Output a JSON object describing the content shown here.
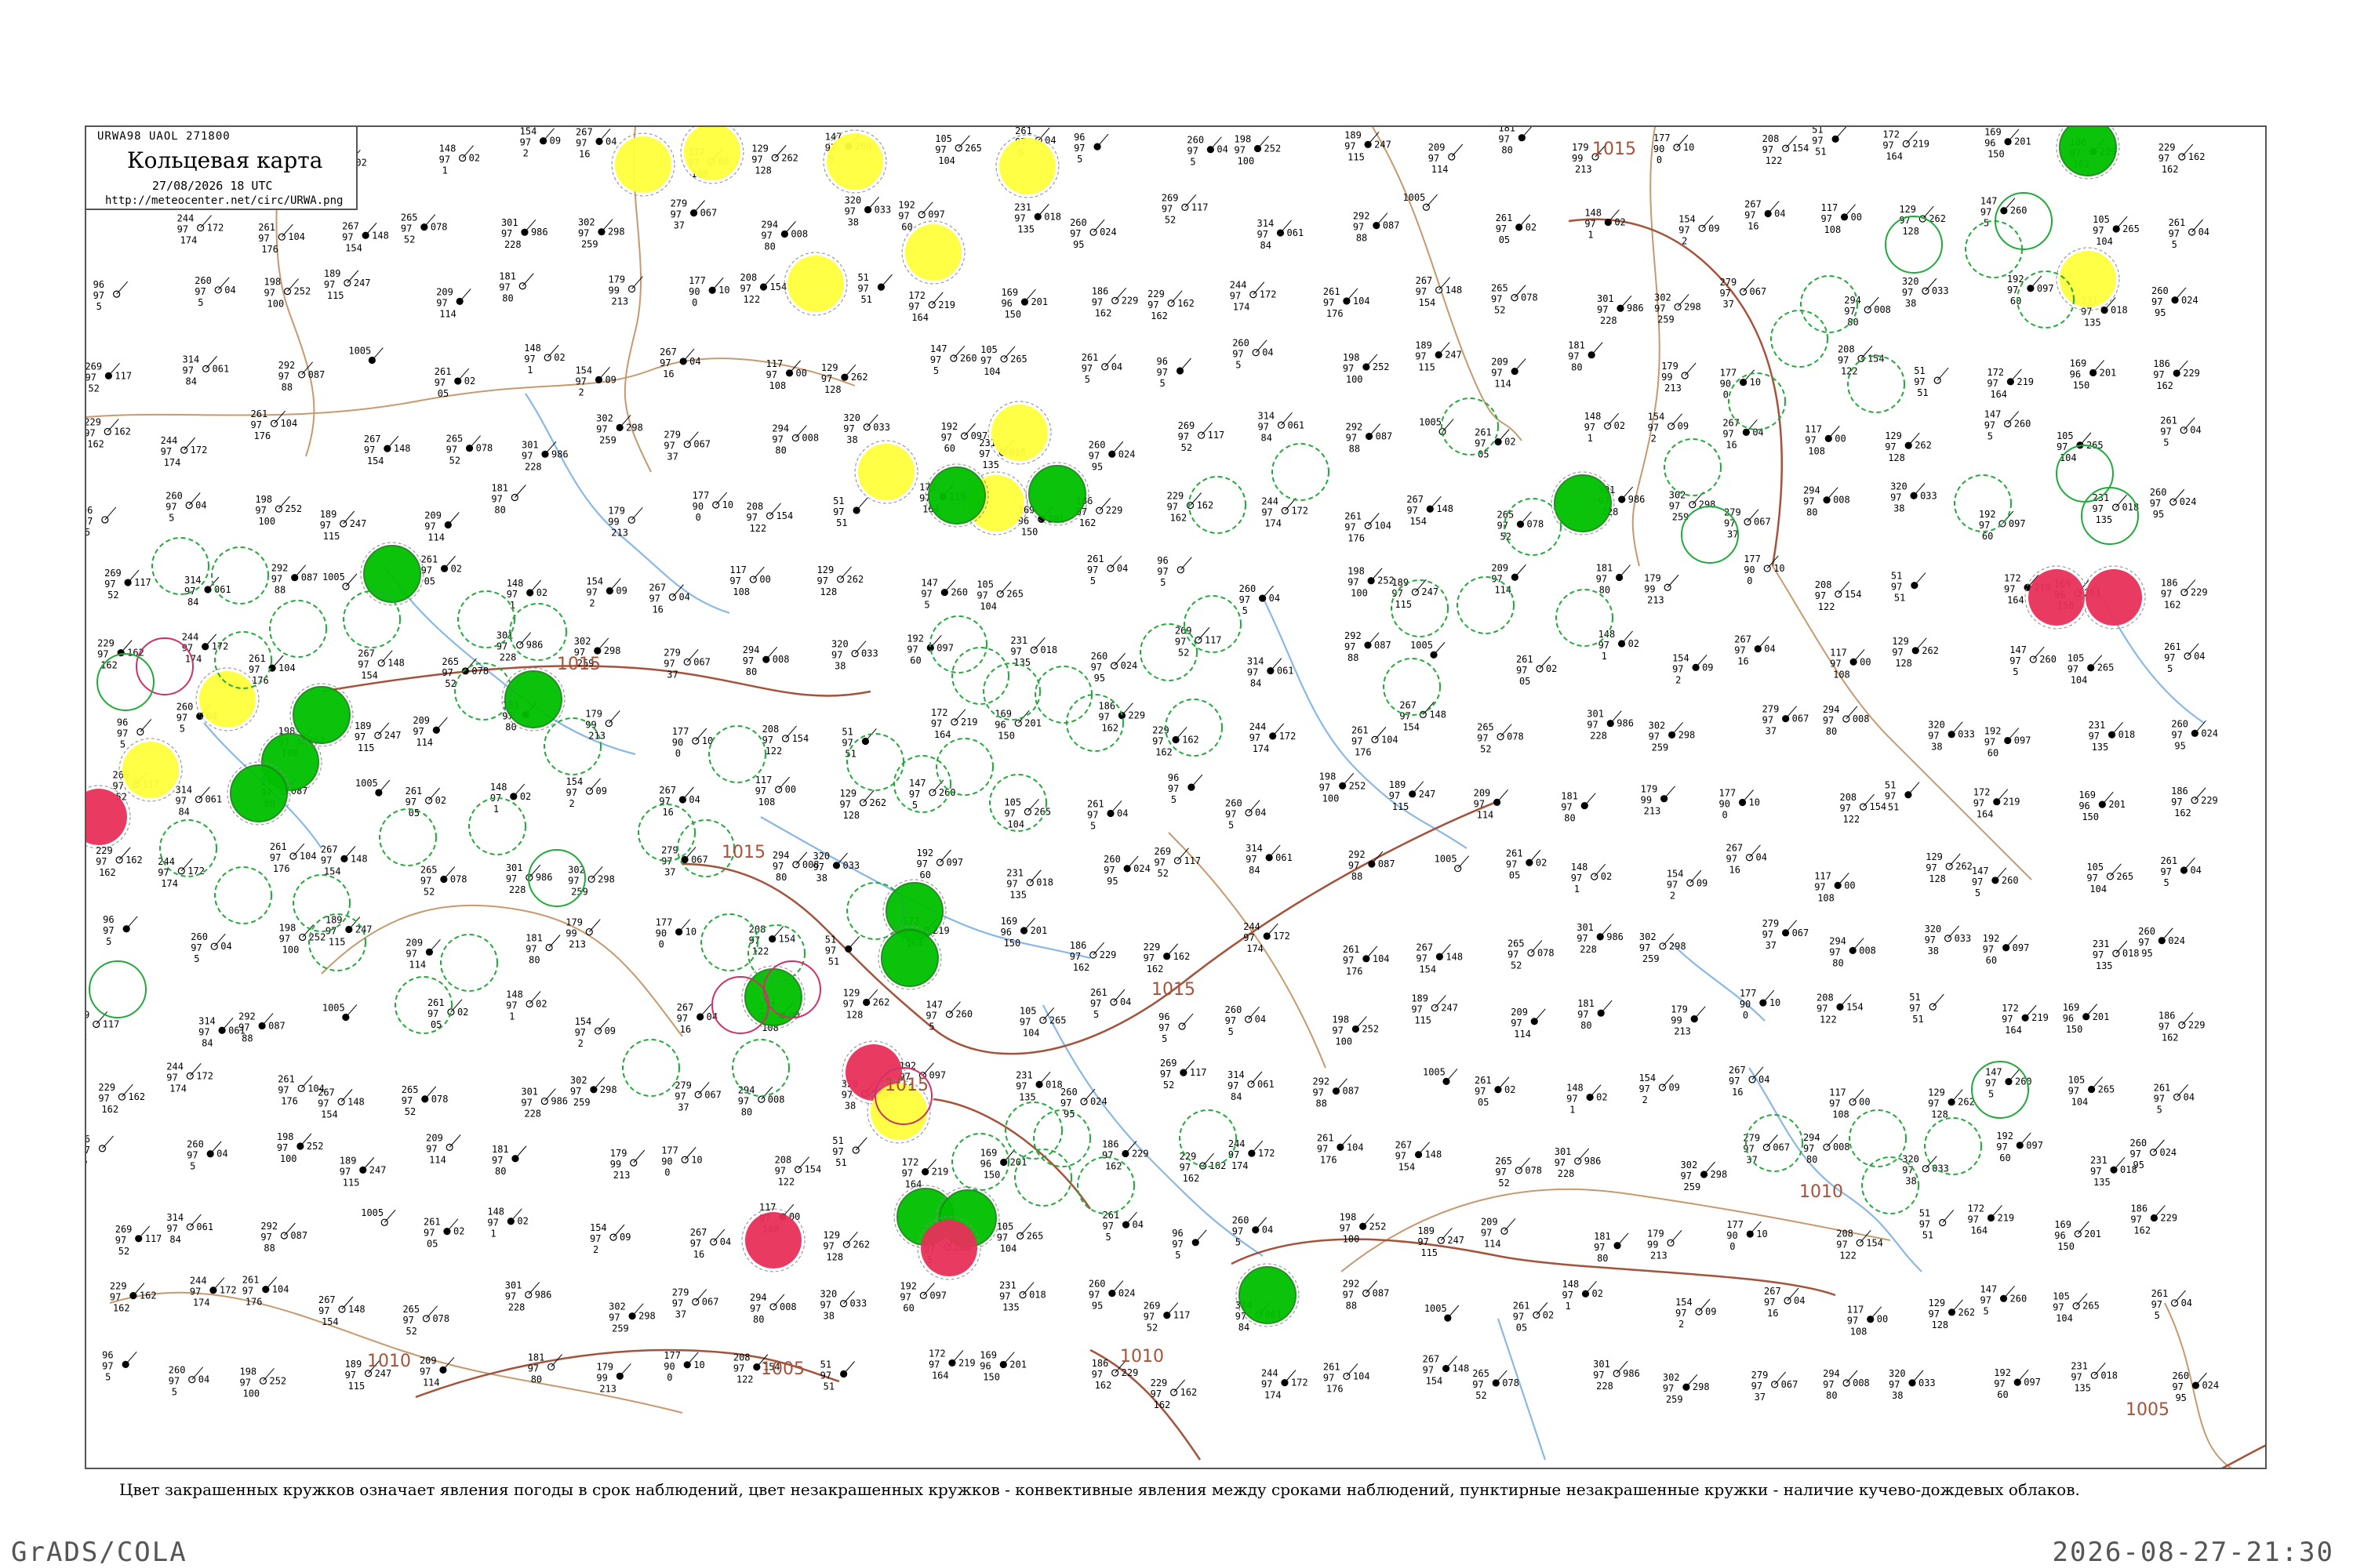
{
  "header": {
    "code_line": "URWA98  UAOL  271800",
    "title": "Кольцевая карта",
    "date_line": "27/08/2026 18 UTC",
    "url": "http://meteocenter.net/circ/URWA.png"
  },
  "isobars": [
    "1015",
    "1015",
    "1015",
    "1015",
    "1015",
    "1010",
    "1010",
    "1010",
    "1005",
    "1005"
  ],
  "legend_note": "Цвет закрашенных кружков означает явления погоды в срок наблюдений, цвет незакрашенных кружков - конвективные явления между сроками наблюдений, пунктирные незакрашенные кружки - наличие кучево-дождевых облаков.",
  "footer": {
    "left": "GrADS/COLA",
    "right": "2026-08-27-21:30"
  },
  "colors": {
    "isobar": "#a5523a",
    "river": "#8ab8e6",
    "border": "#c69a6e",
    "fill_green": "#00c000",
    "fill_yellow": "#ffff3c",
    "fill_yellow_light": "#ffef80",
    "fill_red": "#e8305a",
    "ring_green": "#1faa3a",
    "ring_red": "#d0306a"
  },
  "markers": [
    {
      "type": "filled",
      "color": "fill_green"
    },
    {
      "type": "filled",
      "color": "fill_yellow"
    },
    {
      "type": "filled",
      "color": "fill_red"
    },
    {
      "type": "ring",
      "color": "ring_green"
    },
    {
      "type": "ring-dashed",
      "color": "ring_green"
    },
    {
      "type": "ring",
      "color": "ring_red"
    }
  ],
  "stations": [
    {
      "t": "261",
      "p": "02",
      "v": "97",
      "d": "05"
    },
    {
      "t": "148",
      "p": "02",
      "v": "97",
      "d": "1"
    },
    {
      "t": "154",
      "p": "09",
      "v": "97",
      "d": "2"
    },
    {
      "t": "267",
      "p": "04",
      "v": "97",
      "d": "16"
    },
    {
      "t": "117",
      "p": "00",
      "v": "97",
      "d": "108"
    },
    {
      "t": "129",
      "p": "262",
      "v": "97",
      "d": "128"
    },
    {
      "t": "147",
      "p": "260",
      "v": "97",
      "d": "5"
    },
    {
      "t": "105",
      "p": "265",
      "v": "97",
      "d": "104"
    },
    {
      "t": "261",
      "p": "04",
      "v": "97",
      "d": "5"
    },
    {
      "t": "96",
      "p": "",
      "v": "97",
      "d": "5"
    },
    {
      "t": "260",
      "p": "04",
      "v": "97",
      "d": "5"
    },
    {
      "t": "198",
      "p": "252",
      "v": "97",
      "d": "100"
    },
    {
      "t": "189",
      "p": "247",
      "v": "97",
      "d": "115"
    },
    {
      "t": "209",
      "p": "",
      "v": "97",
      "d": "114"
    },
    {
      "t": "181",
      "p": "",
      "v": "97",
      "d": "80"
    },
    {
      "t": "179",
      "p": "",
      "v": "99",
      "d": "213"
    },
    {
      "t": "177",
      "p": "10",
      "v": "90",
      "d": "0"
    },
    {
      "t": "208",
      "p": "154",
      "v": "97",
      "d": "122"
    },
    {
      "t": "51",
      "p": "",
      "v": "97",
      "d": "51"
    },
    {
      "t": "172",
      "p": "219",
      "v": "97",
      "d": "164"
    },
    {
      "t": "169",
      "p": "201",
      "v": "96",
      "d": "150"
    },
    {
      "t": "186",
      "p": "229",
      "v": "97",
      "d": "162"
    },
    {
      "t": "229",
      "p": "162",
      "v": "97",
      "d": "162"
    },
    {
      "t": "244",
      "p": "172",
      "v": "97",
      "d": "174"
    },
    {
      "t": "261",
      "p": "104",
      "v": "97",
      "d": "176"
    },
    {
      "t": "267",
      "p": "148",
      "v": "97",
      "d": "154"
    },
    {
      "t": "265",
      "p": "078",
      "v": "97",
      "d": "52"
    },
    {
      "t": "301",
      "p": "986",
      "v": "97",
      "d": "228"
    },
    {
      "t": "302",
      "p": "298",
      "v": "97",
      "d": "259"
    },
    {
      "t": "279",
      "p": "067",
      "v": "97",
      "d": "37"
    },
    {
      "t": "294",
      "p": "008",
      "v": "97",
      "d": "80"
    },
    {
      "t": "320",
      "p": "033",
      "v": "97",
      "d": "38"
    },
    {
      "t": "192",
      "p": "097",
      "v": "97",
      "d": "60"
    },
    {
      "t": "231",
      "p": "018",
      "v": "97",
      "d": "135"
    },
    {
      "t": "260",
      "p": "024",
      "v": "97",
      "d": "95"
    },
    {
      "t": "269",
      "p": "117",
      "v": "97",
      "d": "52"
    },
    {
      "t": "314",
      "p": "061",
      "v": "97",
      "d": "84"
    },
    {
      "t": "292",
      "p": "087",
      "v": "97",
      "d": "88"
    },
    {
      "t": "1005",
      "p": "",
      "v": "",
      "d": ""
    }
  ]
}
